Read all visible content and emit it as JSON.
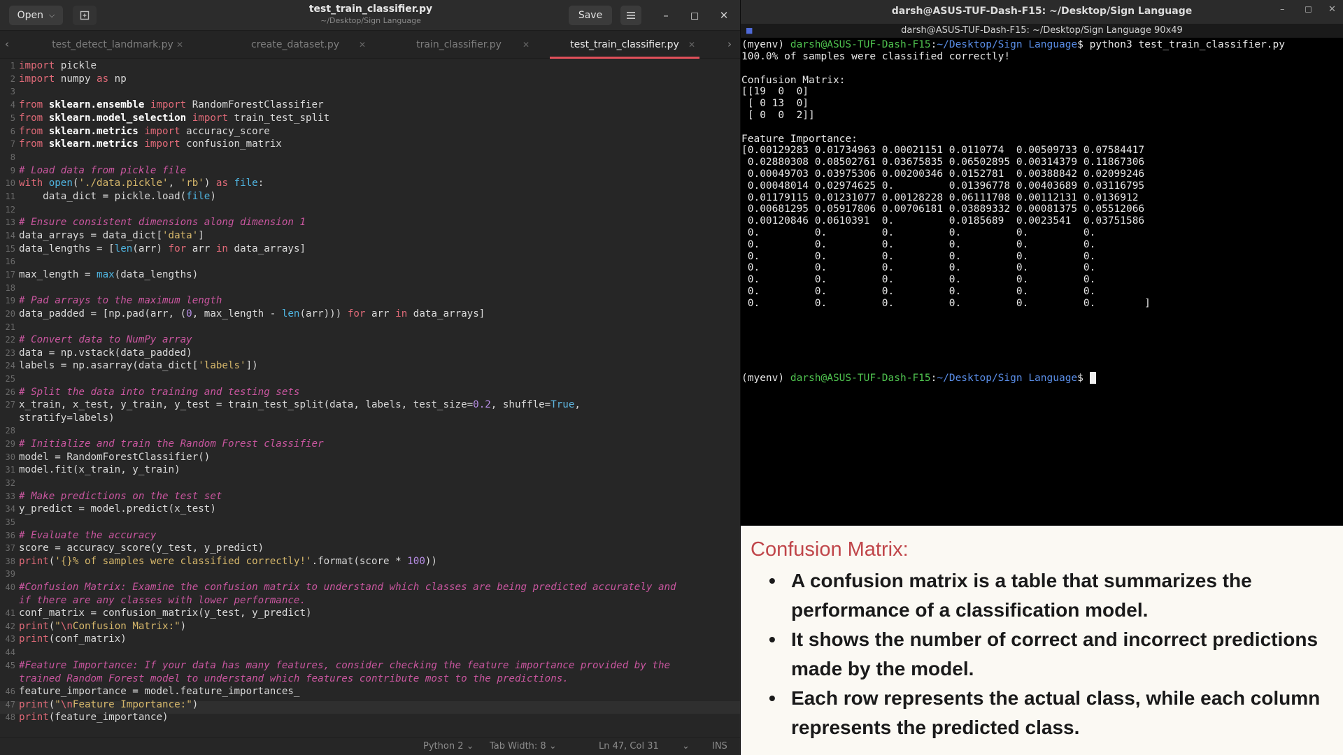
{
  "editor": {
    "open_label": "Open",
    "save_label": "Save",
    "title": "test_train_classifier.py",
    "subtitle": "~/Desktop/Sign Language",
    "tabs": [
      {
        "label": "test_detect_landmark.py",
        "active": false
      },
      {
        "label": "create_dataset.py",
        "active": false
      },
      {
        "label": "train_classifier.py",
        "active": false
      },
      {
        "label": "test_train_classifier.py",
        "active": true
      }
    ],
    "line_numbers": [
      "1",
      "2",
      "3",
      "4",
      "5",
      "6",
      "7",
      "8",
      "9",
      "10",
      "11",
      "12",
      "13",
      "14",
      "15",
      "16",
      "17",
      "18",
      "19",
      "20",
      "21",
      "22",
      "23",
      "24",
      "25",
      "26",
      "27",
      "",
      "28",
      "29",
      "30",
      "31",
      "32",
      "33",
      "34",
      "35",
      "36",
      "37",
      "38",
      "39",
      "40",
      "",
      "41",
      "42",
      "43",
      "44",
      "45",
      "",
      "46",
      "47",
      "48"
    ],
    "status": {
      "language": "Python 2",
      "tab_width": "Tab Width: 8",
      "position": "Ln 47, Col 31",
      "mode": "INS"
    }
  },
  "terminal": {
    "title": "darsh@ASUS-TUF-Dash-F15: ~/Desktop/Sign Language",
    "subtitle": "darsh@ASUS-TUF-Dash-F15: ~/Desktop/Sign Language 90x49",
    "venv": "(myenv) ",
    "host": "darsh@ASUS-TUF-Dash-F15",
    "path": "~/Desktop/Sign Language",
    "command": "python3 test_train_classifier.py",
    "output": [
      "100.0% of samples were classified correctly!",
      "",
      "Confusion Matrix:",
      "[[19  0  0]",
      " [ 0 13  0]",
      " [ 0  0  2]]",
      "",
      "Feature Importance:",
      "[0.00129283 0.01734963 0.00021151 0.0110774  0.00509733 0.07584417",
      " 0.02880308 0.08502761 0.03675835 0.06502895 0.00314379 0.11867306",
      " 0.00049703 0.03975306 0.00200346 0.0152781  0.00388842 0.02099246",
      " 0.00048014 0.02974625 0.         0.01396778 0.00403689 0.03116795",
      " 0.01179115 0.01231077 0.00128228 0.06111708 0.00112131 0.0136912",
      " 0.00681295 0.05917806 0.00706181 0.03889332 0.00081375 0.05512066",
      " 0.00120846 0.0610391  0.         0.0185689  0.0023541  0.03751586",
      " 0.         0.         0.         0.         0.         0.",
      " 0.         0.         0.         0.         0.         0.",
      " 0.         0.         0.         0.         0.         0.",
      " 0.         0.         0.         0.         0.         0.",
      " 0.         0.         0.         0.         0.         0.",
      " 0.         0.         0.         0.         0.         0.",
      " 0.         0.         0.         0.         0.         0.        ]"
    ]
  },
  "panel": {
    "title": "Confusion Matrix:",
    "bullets": [
      "A confusion matrix is a table that summarizes the performance of a classification model.",
      "It shows the number of correct and incorrect predictions made by the model.",
      "Each row represents the actual class, while each column represents the predicted class."
    ]
  },
  "colors": {
    "editor_bg": "#262626",
    "keyword": "#e06a78",
    "comment": "#c9569f",
    "string": "#d7b86b",
    "number": "#b88ee6",
    "builtin": "#4fb4e0",
    "prompt_user": "#4fc34f",
    "prompt_path": "#5a8ee8",
    "panel_title": "#c0464a",
    "tab_active_underline": "#e0505a"
  },
  "icons": [
    "chevron-down-icon",
    "new-tab-icon",
    "hamburger-menu-icon",
    "minimize-icon",
    "maximize-icon",
    "close-icon",
    "chevron-left-icon",
    "chevron-right-icon",
    "terminal-icon"
  ]
}
